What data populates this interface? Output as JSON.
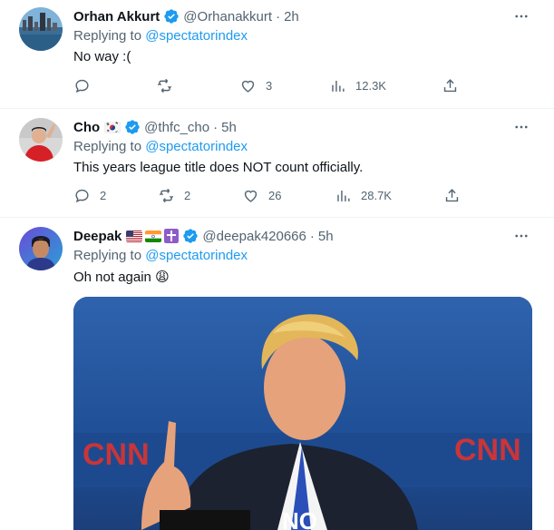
{
  "tweets": [
    {
      "name": "Orhan Akkurt",
      "handle": "@Orhanakkurt",
      "dot": "·",
      "time": "2h",
      "replying_prefix": "Replying to",
      "replying_to": "@spectatorindex",
      "text": "No way :(",
      "replies": "",
      "retweets": "",
      "likes": "3",
      "views": "12.3K"
    },
    {
      "name": "Cho",
      "handle": "@thfc_cho",
      "dot": "·",
      "time": "5h",
      "replying_prefix": "Replying to",
      "replying_to": "@spectatorindex",
      "text": "This years league title does NOT count officially.",
      "replies": "2",
      "retweets": "2",
      "likes": "26",
      "views": "28.7K"
    },
    {
      "name": "Deepak",
      "handle": "@deepak420666",
      "dot": "·",
      "time": "5h",
      "replying_prefix": "Replying to",
      "replying_to": "@spectatorindex",
      "text": "Oh not again 😩",
      "media_caption": "NO"
    }
  ],
  "colors": {
    "link": "#1d9bf0",
    "muted": "#536471",
    "verified": "#1d9bf0"
  },
  "icons": [
    "reply-icon",
    "retweet-icon",
    "like-icon",
    "views-icon",
    "share-icon",
    "more-icon",
    "verified-icon"
  ]
}
